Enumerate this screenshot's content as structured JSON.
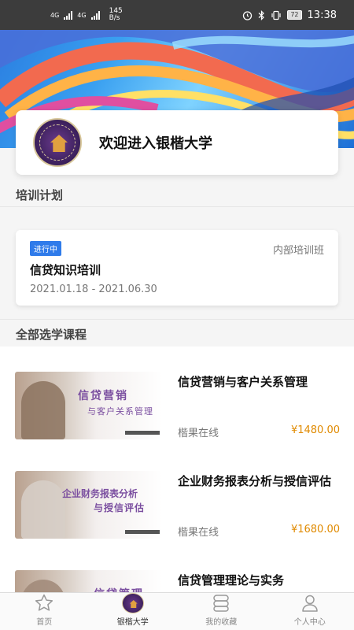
{
  "status_bar": {
    "network_1": "4G",
    "network_2": "4G",
    "speed_value": "145",
    "speed_unit": "B/s",
    "battery": "72",
    "time": "13:38"
  },
  "welcome": {
    "title": "欢迎进入银楷大学"
  },
  "training_plan": {
    "section_title": "培训计划",
    "badge": "进行中",
    "type": "内部培训班",
    "name": "信贷知识培训",
    "dates": "2021.01.18 - 2021.06.30"
  },
  "courses_section": {
    "title": "全部选学课程",
    "items": [
      {
        "title": "信贷营销与客户关系管理",
        "provider": "楷果在线",
        "price": "¥1480.00",
        "thumb_line1": "信贷营销",
        "thumb_line2": "与客户关系管理"
      },
      {
        "title": "企业财务报表分析与授信评估",
        "provider": "楷果在线",
        "price": "¥1680.00",
        "thumb_line1": "企业财务报表分析",
        "thumb_line2": "与授信评估"
      },
      {
        "title": "信贷管理理论与实务",
        "provider": "",
        "price": "",
        "thumb_line1": "信贷管理",
        "thumb_line2": ""
      }
    ]
  },
  "tabbar": {
    "items": [
      {
        "label": "首页",
        "icon": "star-icon"
      },
      {
        "label": "银楷大学",
        "icon": "university-logo-icon"
      },
      {
        "label": "我的收藏",
        "icon": "favorites-icon"
      },
      {
        "label": "个人中心",
        "icon": "person-icon"
      }
    ],
    "active_index": 1
  },
  "colors": {
    "accent": "#2f7bea",
    "price": "#e08a00",
    "brand_purple": "#3a1f5a"
  }
}
